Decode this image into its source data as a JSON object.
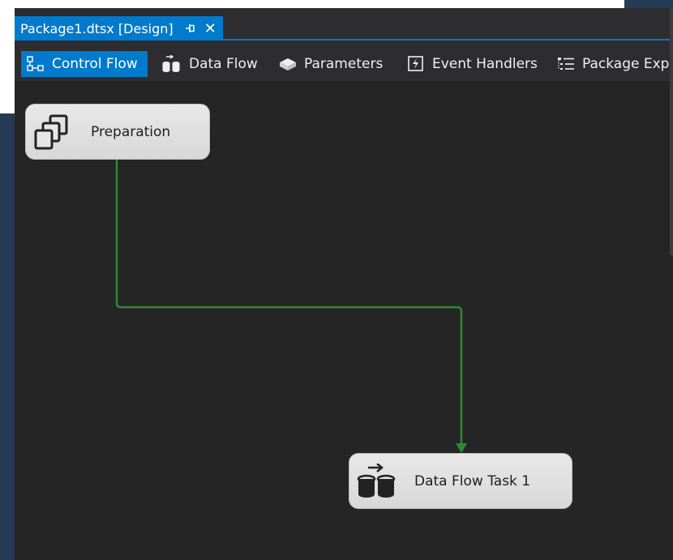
{
  "document_tab": {
    "title": "Package1.dtsx [Design]",
    "pin_icon": "pin-icon",
    "close_icon": "close-icon"
  },
  "designer_tabs": [
    {
      "label": "Control Flow",
      "icon": "control-flow-icon",
      "active": true
    },
    {
      "label": "Data Flow",
      "icon": "data-flow-icon",
      "active": false
    },
    {
      "label": "Parameters",
      "icon": "parameters-icon",
      "active": false
    },
    {
      "label": "Event Handlers",
      "icon": "event-handlers-icon",
      "active": false
    },
    {
      "label": "Package Exp",
      "icon": "package-explorer-icon",
      "active": false
    }
  ],
  "tasks": [
    {
      "label": "Preparation",
      "icon": "sequence-container-icon"
    },
    {
      "label": "Data Flow Task 1",
      "icon": "data-flow-task-icon"
    }
  ],
  "colors": {
    "accent": "#007acc",
    "canvas": "#252526",
    "connector": "#2e8b2e",
    "task_fill": "#e0e0e0"
  }
}
